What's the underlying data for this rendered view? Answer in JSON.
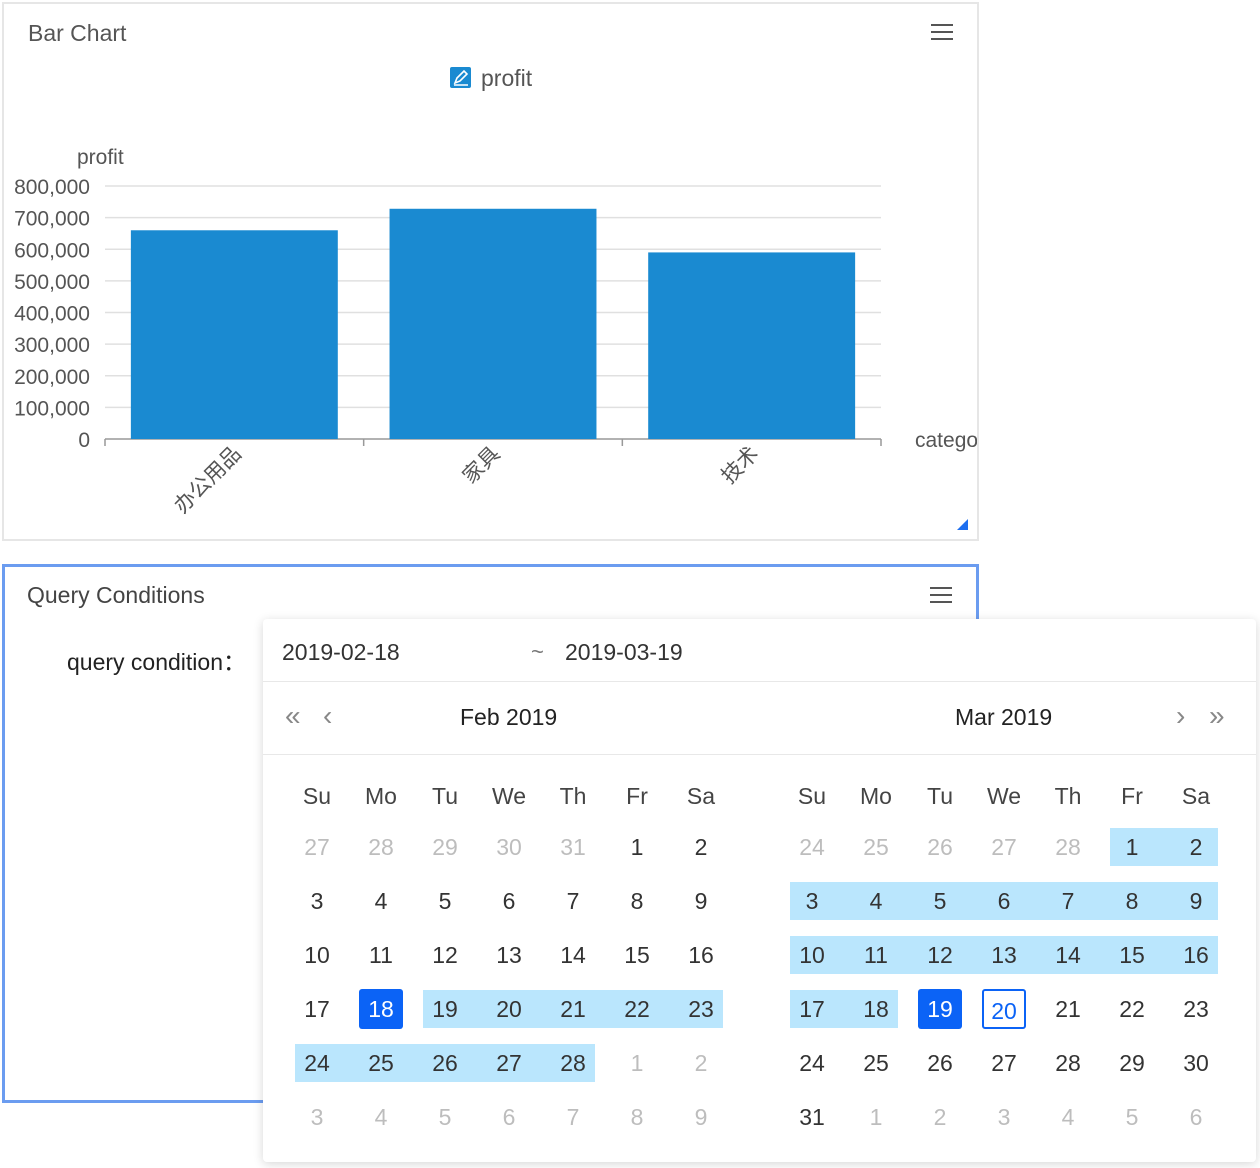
{
  "chart_panel": {
    "title": "Bar Chart"
  },
  "chart_data": {
    "type": "bar",
    "title": "profit",
    "categories": [
      "办公用品",
      "家具",
      "技术"
    ],
    "values": [
      660000,
      728000,
      590000
    ],
    "ylabel": "profit",
    "xlabel": "catego",
    "ylim": [
      0,
      800000
    ],
    "yticks": [
      "0",
      "100,000",
      "200,000",
      "300,000",
      "400,000",
      "500,000",
      "600,000",
      "700,000",
      "800,000"
    ],
    "bar_color": "#1a8ad1",
    "grid": true,
    "legend_position": "top-center"
  },
  "query_panel": {
    "title": "Query Conditions",
    "label": "query condition："
  },
  "range_picker": {
    "start": "2019-02-18",
    "separator": "~",
    "end": "2019-03-19",
    "prev_year": "«",
    "prev_month": "‹",
    "next_month": "›",
    "next_year": "»",
    "weekdays": [
      "Su",
      "Mo",
      "Tu",
      "We",
      "Th",
      "Fr",
      "Sa"
    ],
    "left": {
      "title": "Feb 2019",
      "days": [
        {
          "n": "27",
          "o": 1
        },
        {
          "n": "28",
          "o": 1
        },
        {
          "n": "29",
          "o": 1
        },
        {
          "n": "30",
          "o": 1
        },
        {
          "n": "31",
          "o": 1
        },
        {
          "n": "1"
        },
        {
          "n": "2"
        },
        {
          "n": "3"
        },
        {
          "n": "4"
        },
        {
          "n": "5"
        },
        {
          "n": "6"
        },
        {
          "n": "7"
        },
        {
          "n": "8"
        },
        {
          "n": "9"
        },
        {
          "n": "10"
        },
        {
          "n": "11"
        },
        {
          "n": "12"
        },
        {
          "n": "13"
        },
        {
          "n": "14"
        },
        {
          "n": "15"
        },
        {
          "n": "16"
        },
        {
          "n": "17"
        },
        {
          "n": "18",
          "s": 1
        },
        {
          "n": "19",
          "r": 1
        },
        {
          "n": "20",
          "r": 1
        },
        {
          "n": "21",
          "r": 1
        },
        {
          "n": "22",
          "r": 1
        },
        {
          "n": "23",
          "r": 1
        },
        {
          "n": "24",
          "r": 1
        },
        {
          "n": "25",
          "r": 1
        },
        {
          "n": "26",
          "r": 1
        },
        {
          "n": "27",
          "r": 1
        },
        {
          "n": "28",
          "r": 1
        },
        {
          "n": "1",
          "o": 1
        },
        {
          "n": "2",
          "o": 1
        },
        {
          "n": "3",
          "o": 1
        },
        {
          "n": "4",
          "o": 1
        },
        {
          "n": "5",
          "o": 1
        },
        {
          "n": "6",
          "o": 1
        },
        {
          "n": "7",
          "o": 1
        },
        {
          "n": "8",
          "o": 1
        },
        {
          "n": "9",
          "o": 1
        }
      ]
    },
    "right": {
      "title": "Mar 2019",
      "days": [
        {
          "n": "24",
          "o": 1
        },
        {
          "n": "25",
          "o": 1
        },
        {
          "n": "26",
          "o": 1
        },
        {
          "n": "27",
          "o": 1
        },
        {
          "n": "28",
          "o": 1
        },
        {
          "n": "1",
          "r": 1
        },
        {
          "n": "2",
          "r": 1
        },
        {
          "n": "3",
          "r": 1
        },
        {
          "n": "4",
          "r": 1
        },
        {
          "n": "5",
          "r": 1
        },
        {
          "n": "6",
          "r": 1
        },
        {
          "n": "7",
          "r": 1
        },
        {
          "n": "8",
          "r": 1
        },
        {
          "n": "9",
          "r": 1
        },
        {
          "n": "10",
          "r": 1
        },
        {
          "n": "11",
          "r": 1
        },
        {
          "n": "12",
          "r": 1
        },
        {
          "n": "13",
          "r": 1
        },
        {
          "n": "14",
          "r": 1
        },
        {
          "n": "15",
          "r": 1
        },
        {
          "n": "16",
          "r": 1
        },
        {
          "n": "17",
          "r": 1
        },
        {
          "n": "18",
          "r": 1
        },
        {
          "n": "19",
          "s": 1
        },
        {
          "n": "20",
          "t": 1
        },
        {
          "n": "21"
        },
        {
          "n": "22"
        },
        {
          "n": "23"
        },
        {
          "n": "24"
        },
        {
          "n": "25"
        },
        {
          "n": "26"
        },
        {
          "n": "27"
        },
        {
          "n": "28"
        },
        {
          "n": "29"
        },
        {
          "n": "30"
        },
        {
          "n": "31"
        },
        {
          "n": "1",
          "o": 1
        },
        {
          "n": "2",
          "o": 1
        },
        {
          "n": "3",
          "o": 1
        },
        {
          "n": "4",
          "o": 1
        },
        {
          "n": "5",
          "o": 1
        },
        {
          "n": "6",
          "o": 1
        }
      ]
    }
  }
}
